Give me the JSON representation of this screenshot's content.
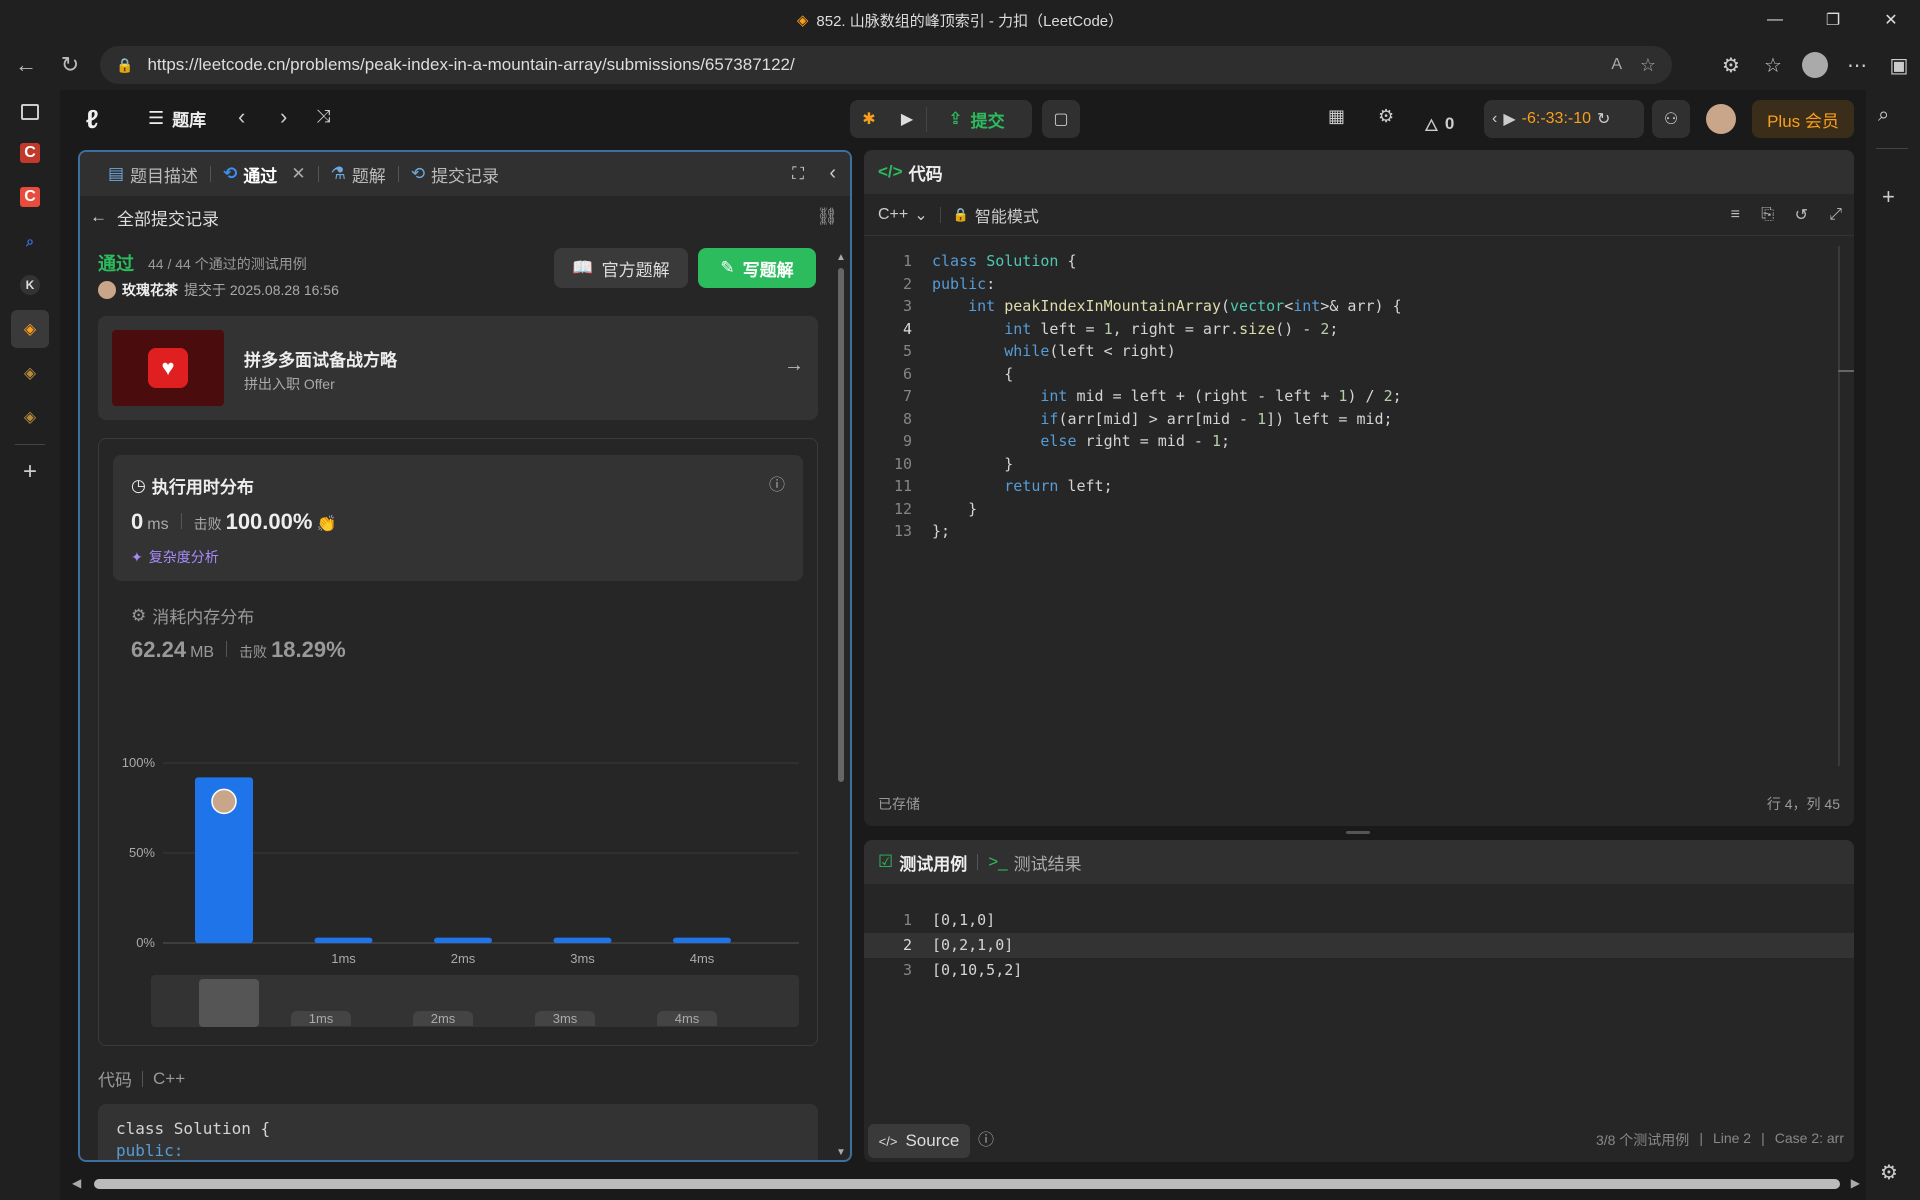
{
  "browser": {
    "window_title": "852. 山脉数组的峰顶索引 - 力扣（LeetCode）",
    "url": "https://leetcode.cn/problems/peak-index-in-a-mountain-array/submissions/657387122/"
  },
  "sidebar": {
    "items": [
      {
        "icon": "tabs-icon",
        "label": ""
      },
      {
        "icon": "c-red-icon",
        "label": "C"
      },
      {
        "icon": "c-orange-icon",
        "label": "C"
      },
      {
        "icon": "search-small-icon",
        "label": ""
      },
      {
        "icon": "k-icon",
        "label": "K"
      },
      {
        "icon": "leetcode-icon",
        "label": ""
      },
      {
        "icon": "leetcode-icon-2",
        "label": ""
      },
      {
        "icon": "leetcode-icon-3",
        "label": ""
      }
    ]
  },
  "topnav": {
    "problem_list": "题库",
    "submit": "提交",
    "fire_count": "0",
    "timer": "-6:-33:-10",
    "plus": "Plus 会员"
  },
  "left": {
    "tabs": [
      "题目描述",
      "通过",
      "题解",
      "提交记录"
    ],
    "back_label": "全部提交记录",
    "status": "通过",
    "passed_cases": "44 / 44 个通过的测试用例",
    "user": "玫瑰花茶",
    "submitted_at": "提交于 2025.08.28 16:56",
    "official_solution": "官方题解",
    "write_solution": "写题解",
    "banner_title": "拼多多面试备战方略",
    "banner_subtitle": "拼出入职 Offer",
    "runtime_title": "执行用时分布",
    "runtime_value": "0",
    "runtime_unit": "ms",
    "beats_label": "击败",
    "runtime_beats": "100.00%",
    "complexity": "复杂度分析",
    "memory_title": "消耗内存分布",
    "memory_value": "62.24",
    "memory_unit": "MB",
    "memory_beats": "18.29%",
    "code_label": "代码",
    "code_lang": "C++",
    "code_preview_1": "class Solution {",
    "code_preview_2": "public:"
  },
  "chart_data": {
    "type": "bar",
    "categories": [
      "0ms",
      "1ms",
      "2ms",
      "3ms",
      "4ms"
    ],
    "values": [
      92,
      3,
      3,
      3,
      3
    ],
    "x_tick_labels": [
      "",
      "1ms",
      "2ms",
      "3ms",
      "4ms"
    ],
    "y_tick_labels": [
      "100%",
      "50%",
      "0%"
    ],
    "ylim": [
      0,
      100
    ]
  },
  "editor": {
    "title": "代码",
    "language": "C++",
    "mode": "智能模式",
    "saved": "已存储",
    "cursor": "行 4，列 45",
    "lines": [
      "class Solution {",
      "public:",
      "    int peakIndexInMountainArray(vector<int>& arr) {",
      "        int left = 1, right = arr.size() - 2;",
      "        while(left < right)",
      "        {",
      "            int mid = left + (right - left + 1) / 2;",
      "            if(arr[mid] > arr[mid - 1]) left = mid;",
      "            else right = mid - 1;",
      "        }",
      "        return left;",
      "    }",
      "};"
    ]
  },
  "tests": {
    "tab_cases": "测试用例",
    "tab_results": "测试结果",
    "cases": [
      "[0,1,0]",
      "[0,2,1,0]",
      "[0,10,5,2]"
    ],
    "source": "Source",
    "status": "3/8 个测试用例",
    "line": "Line 2",
    "case": "Case 2: arr"
  }
}
